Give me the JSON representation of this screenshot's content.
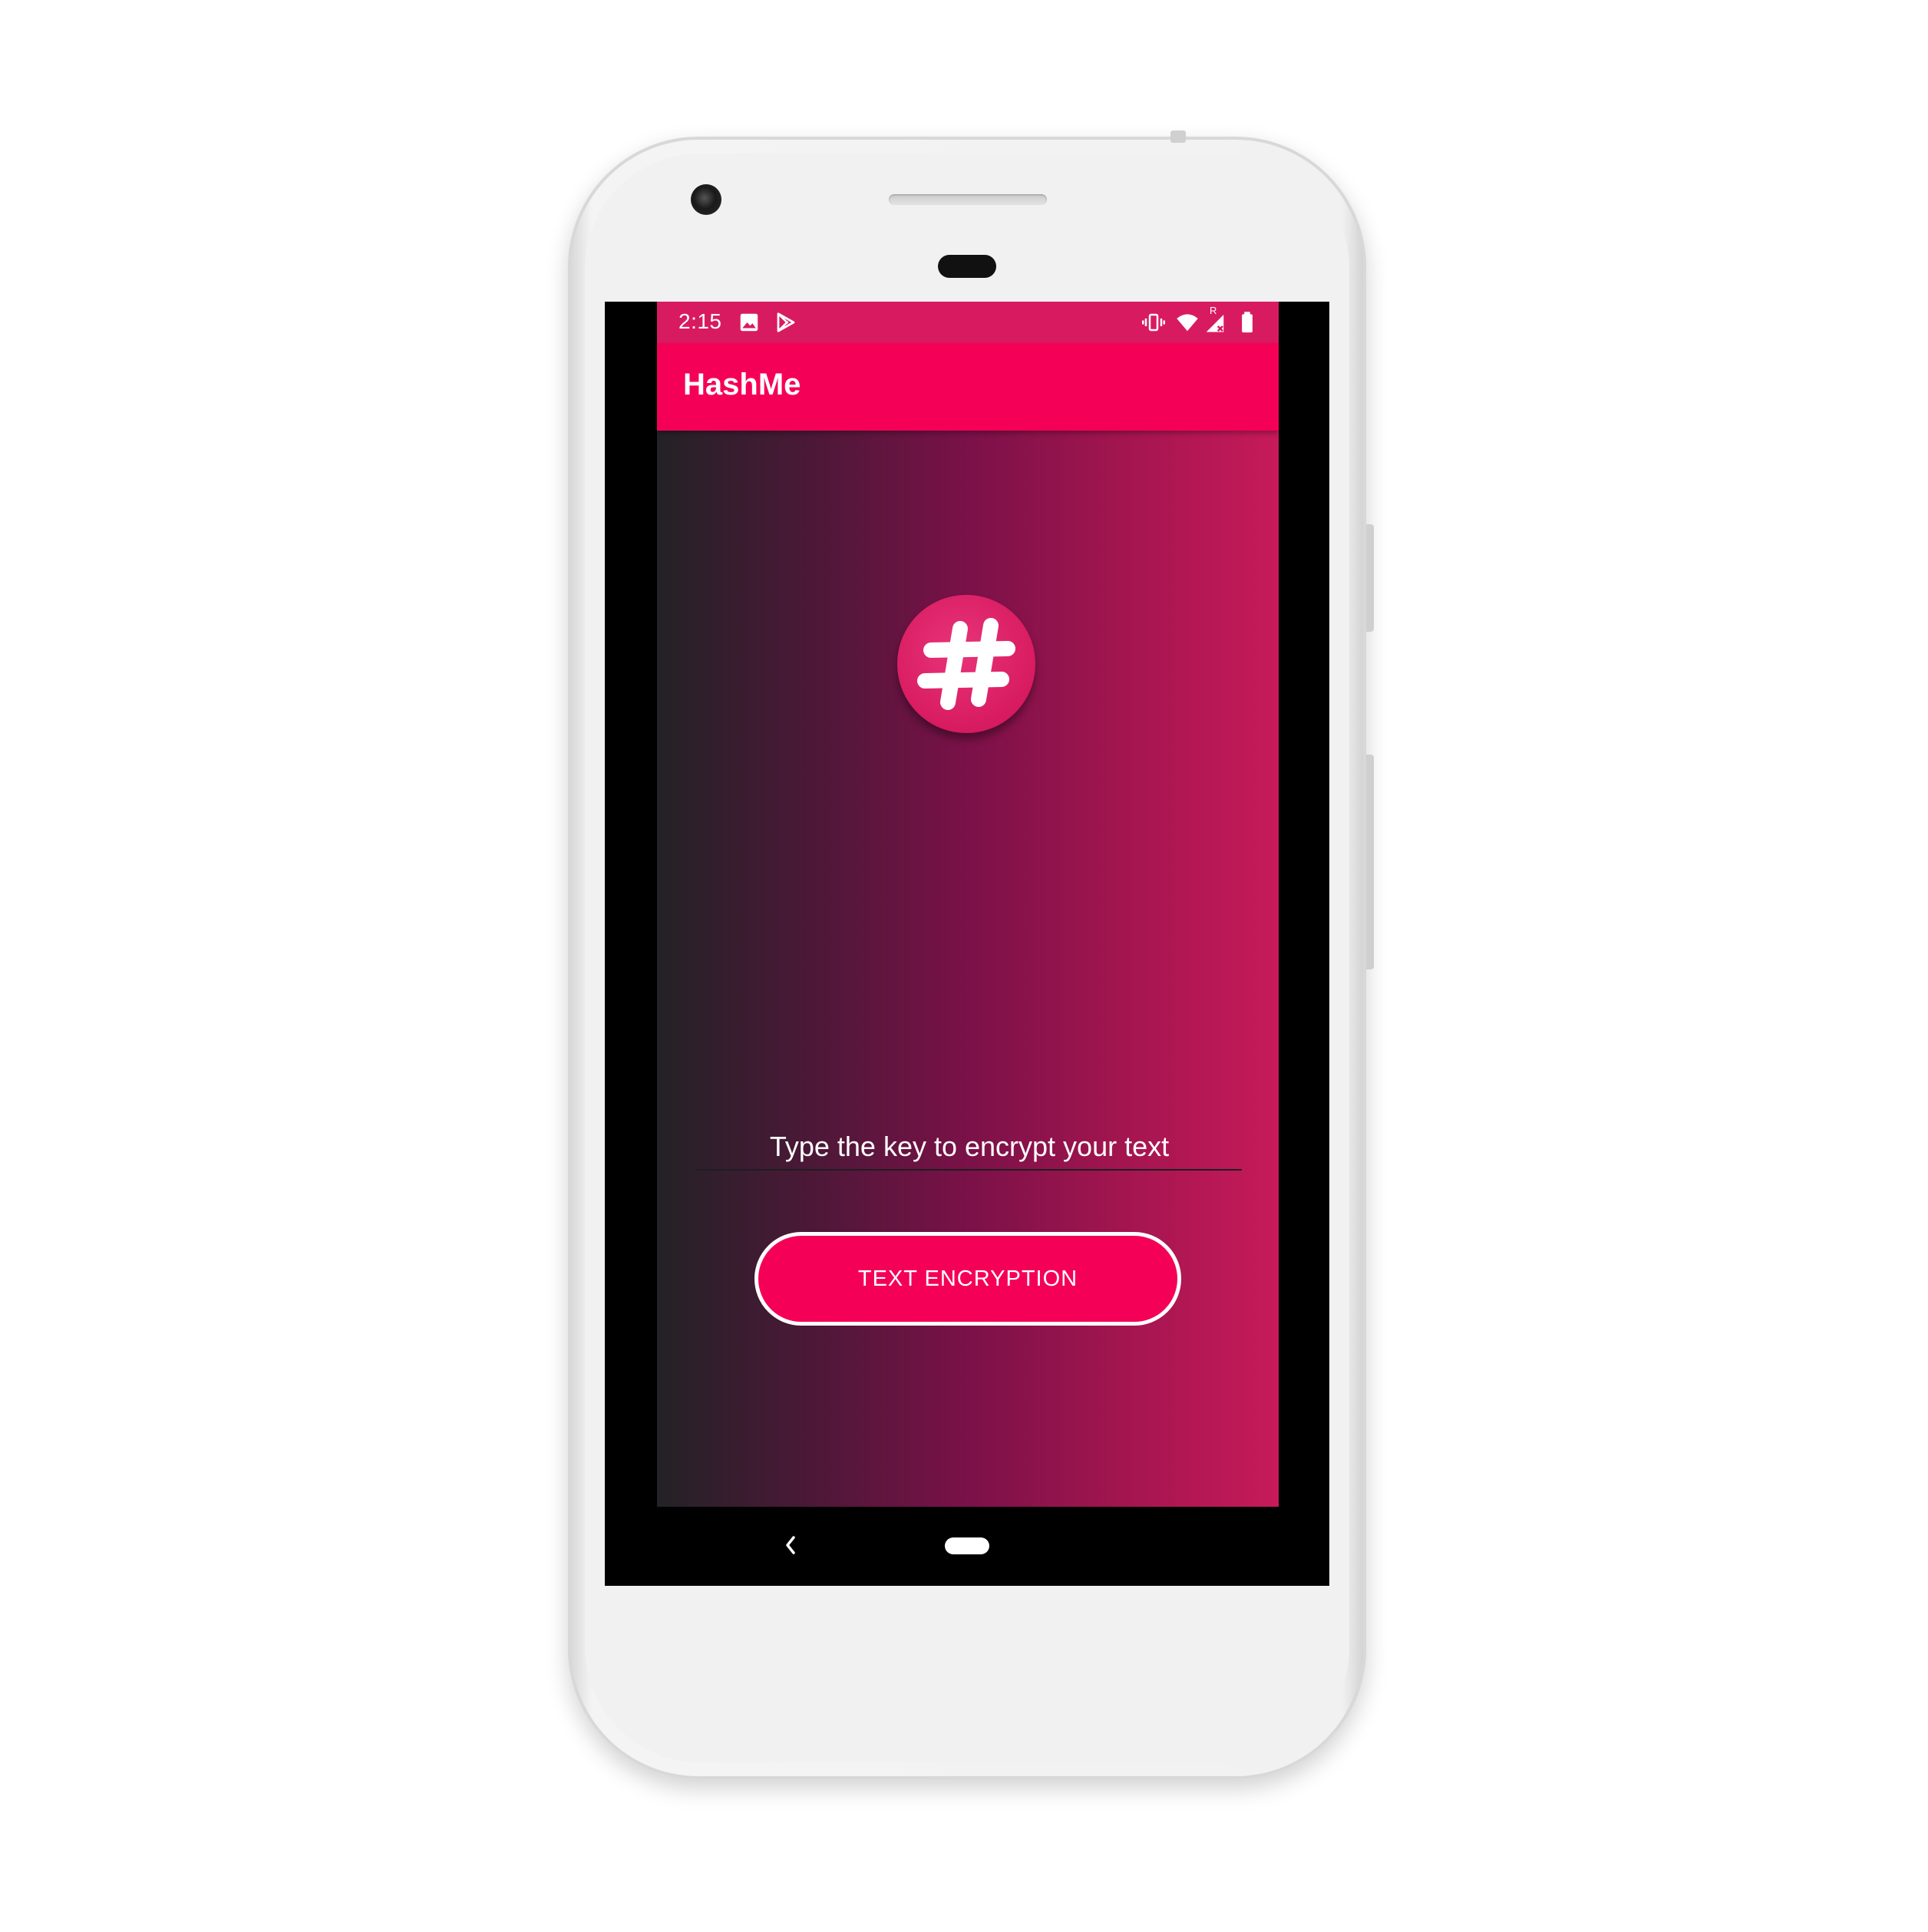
{
  "status_bar": {
    "time": "2:15",
    "left_icons": [
      "image-icon",
      "play-store-icon"
    ],
    "right_icons": [
      "vibrate-icon",
      "wifi-icon",
      "signal-roaming-icon",
      "battery-icon"
    ],
    "roaming_indicator": "R"
  },
  "app": {
    "title": "HashMe",
    "logo_icon": "hash-icon",
    "key_input": {
      "placeholder": "Type the key to encrypt your text",
      "value": ""
    },
    "encrypt_button_label": "TEXT ENCRYPTION"
  },
  "navigation": {
    "back_icon": "back-chevron-icon",
    "home_icon": "home-pill-icon"
  },
  "colors": {
    "status_bar": "#d81b60",
    "toolbar": "#f50057",
    "accent": "#f50057",
    "gradient_start": "#232226",
    "gradient_end": "#c71a5a",
    "text": "#ffffff"
  }
}
